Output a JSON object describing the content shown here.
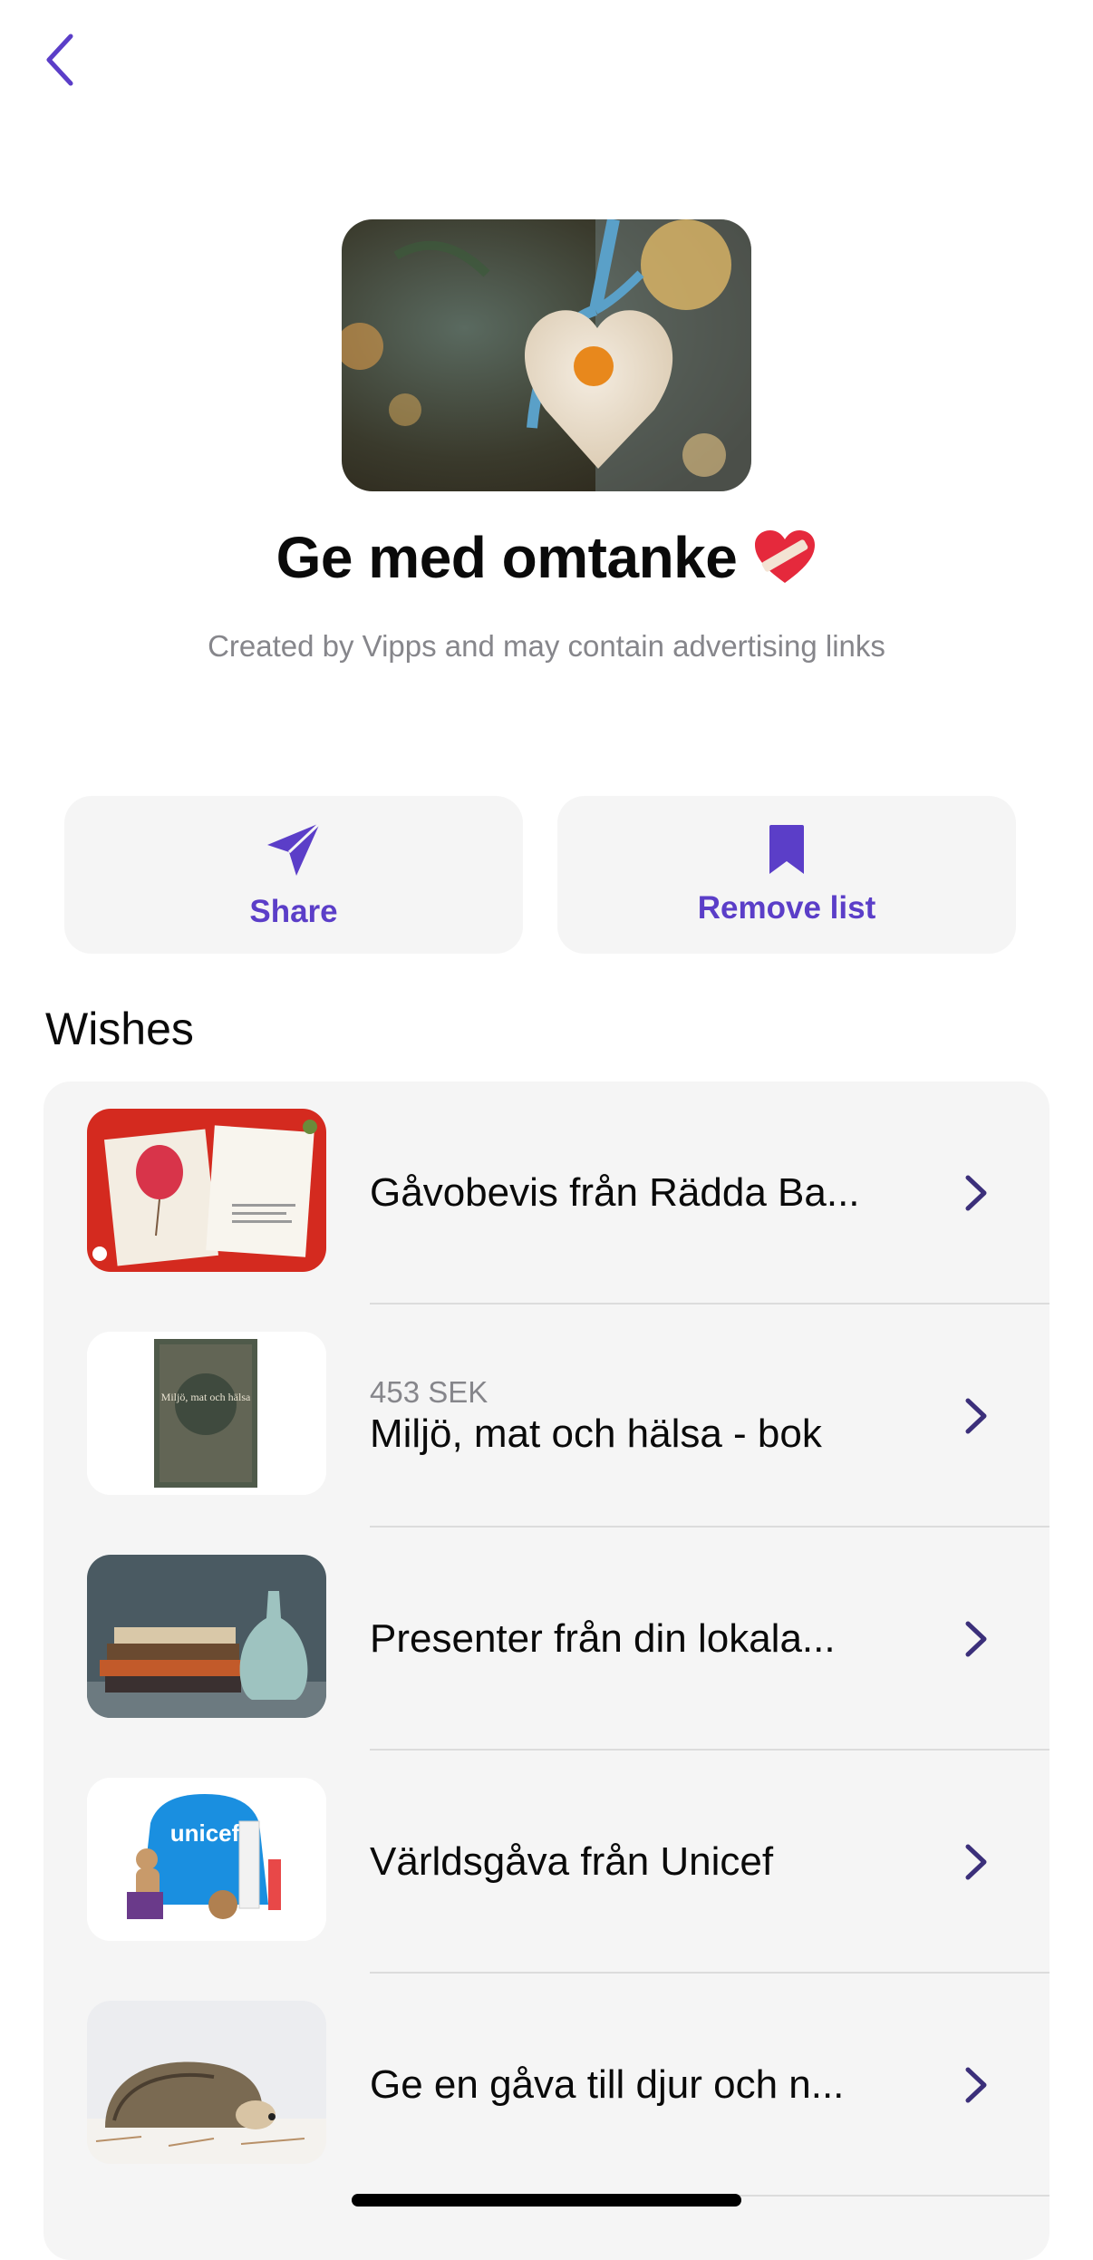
{
  "nav": {
    "back_icon": "chevron-left-icon"
  },
  "header": {
    "title": "Ge med omtanke",
    "title_emoji": "❤️‍🩹",
    "subtitle": "Created by Vipps and may contain advertising links"
  },
  "actions": {
    "share_label": "Share",
    "share_icon": "paper-plane-icon",
    "remove_label": "Remove list",
    "remove_icon": "bookmark-icon"
  },
  "wishes": {
    "section_title": "Wishes",
    "items": [
      {
        "price": "",
        "name": "Gåvobevis från Rädda Ba..."
      },
      {
        "price": "453 SEK",
        "name": "Miljö, mat och hälsa - bok",
        "book_title": "Miljö, mat och hälsa"
      },
      {
        "price": "",
        "name": "Presenter från din lokala..."
      },
      {
        "price": "",
        "name": "Världsgåva från Unicef",
        "logo_text": "unicef"
      },
      {
        "price": "",
        "name": "Ge en gåva till djur och n..."
      }
    ]
  },
  "colors": {
    "accent": "#5b3ec8",
    "chevron": "#3b2f7a",
    "card_bg": "#f5f5f5",
    "muted_text": "#86868b"
  }
}
